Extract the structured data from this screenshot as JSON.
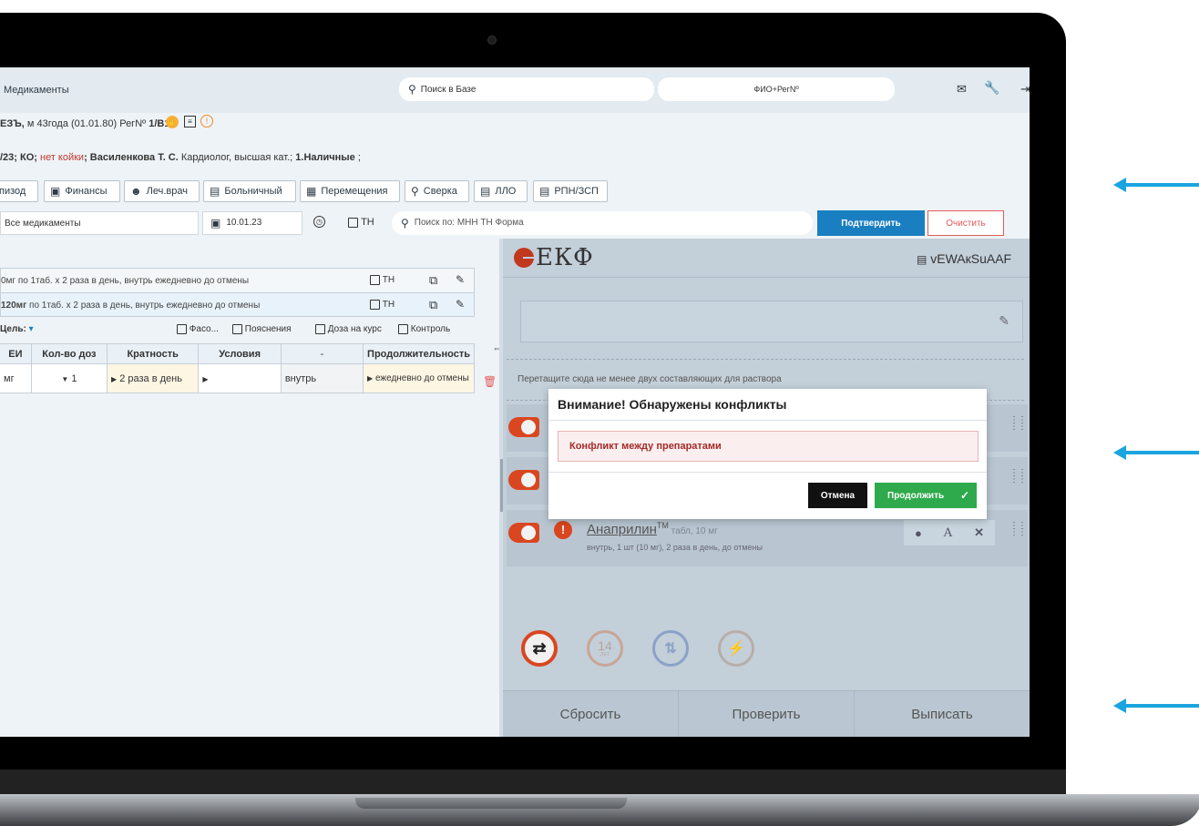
{
  "header": {
    "title": "Медикаменты",
    "search_base": "Поиск в Базе",
    "patient_search": "ФИО+РегNº"
  },
  "patient": {
    "name": "ЕЗЪ,",
    "info": " м 43года (01.01.80) РегNº ",
    "reg": "1/В17"
  },
  "episode": {
    "prefix": "/23; КО; ",
    "no_bed": "нет койки",
    "doctor": "; Василенкова Т. С.",
    "specialty": " Кардиолог, высшая кат.; ",
    "payment": "1.Наличные",
    "tail": " ;"
  },
  "toolbar": {
    "episode": "пизод",
    "finance": "Финансы",
    "doctor": "Леч.врач",
    "sick_leave": "Больничный",
    "moves": "Перемещения",
    "reconcile": "Сверка",
    "llo": "ЛЛО",
    "rpn": "РПН/ЗСП"
  },
  "filter": {
    "all_meds": "Все медикаменты",
    "date": "10.01.23",
    "tn": "ТН",
    "search_placeholder": "Поиск по: МНН ТН Форма",
    "confirm": "Подтвердить",
    "clear": "Очистить"
  },
  "prescriptions": [
    {
      "text": "0мг по 1таб. х 2 раза в день, внутрь ежедневно до отмены",
      "tn": "ТН"
    },
    {
      "text": "120мг",
      "rest": " по 1таб. х 2 раза в день, внутрь ежедневно до отмены",
      "tn": "ТН"
    }
  ],
  "options": {
    "goal": "Цель:",
    "faso": "Фасо...",
    "notes": "Пояснения",
    "course_dose": "Доза на курс",
    "control": "Контроль"
  },
  "dose_table": {
    "headers": [
      "ЕИ",
      "Кол-во доз",
      "Кратность",
      "Условия",
      "-",
      "Продолжительность"
    ],
    "row": [
      "мг",
      "1",
      "2 раза в день",
      "",
      "внутрь",
      "ежедневно до отмены"
    ]
  },
  "right_panel": {
    "logo_text": "ЕКФ",
    "bed_code": "vEWAкSuAAF",
    "drop_hint": "Перетащите сюда не менее двух составляющих для раствора",
    "drug_name": "Анаприлин",
    "drug_tm": "TM",
    "drug_form": " табл, 10 мг",
    "drug_instr": "внутрь, 1 шт (10 мг), 2 раза в день, до отмены",
    "age_badge": "14",
    "age_unit": "ЛЕТ",
    "reset": "Сбросить",
    "check": "Проверить",
    "prescribe": "Выписать"
  },
  "modal": {
    "title": "Внимание! Обнаружены конфликты",
    "message": "Конфликт между препаратами",
    "cancel": "Отмена",
    "continue": "Продолжить"
  },
  "colors": {
    "accent_blue": "#1a7fc1",
    "danger_red": "#d9461f",
    "success_green": "#2eaa4c",
    "arrow_blue": "#1aa4e0"
  }
}
